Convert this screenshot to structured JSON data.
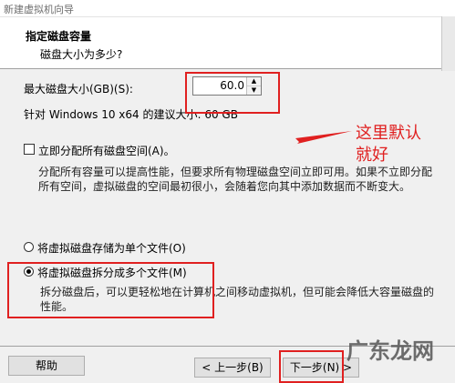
{
  "window": {
    "title": "新建虚拟机向导"
  },
  "header": {
    "title": "指定磁盘容量",
    "subtitle": "磁盘大小为多少?"
  },
  "disk": {
    "size_label": "最大磁盘大小(GB)(S):",
    "size_value": "60.0",
    "recommended": "针对 Windows 10 x64 的建议大小: 60 GB"
  },
  "allocate": {
    "label": "立即分配所有磁盘空间(A)。",
    "checked": false,
    "description": "分配所有容量可以提高性能，但要求所有物理磁盘空间立即可用。如果不立即分配所有空间，虚拟磁盘的空间最初很小，会随着您向其中添加数据而不断变大。"
  },
  "storage": {
    "single_label": "将虚拟磁盘存储为单个文件(O)",
    "multi_label": "将虚拟磁盘拆分成多个文件(M)",
    "selected": "multi",
    "multi_description": "拆分磁盘后，可以更轻松地在计算机之间移动虚拟机，但可能会降低大容量磁盘的性能。"
  },
  "buttons": {
    "help": "帮助",
    "back": "< 上一步(B)",
    "next": "下一步(N) >"
  },
  "annotation": {
    "text": "这里默认就好",
    "color": "#e02020"
  },
  "watermark": {
    "text": "广东龙网"
  },
  "spin_up": "▲",
  "spin_down": "▼"
}
